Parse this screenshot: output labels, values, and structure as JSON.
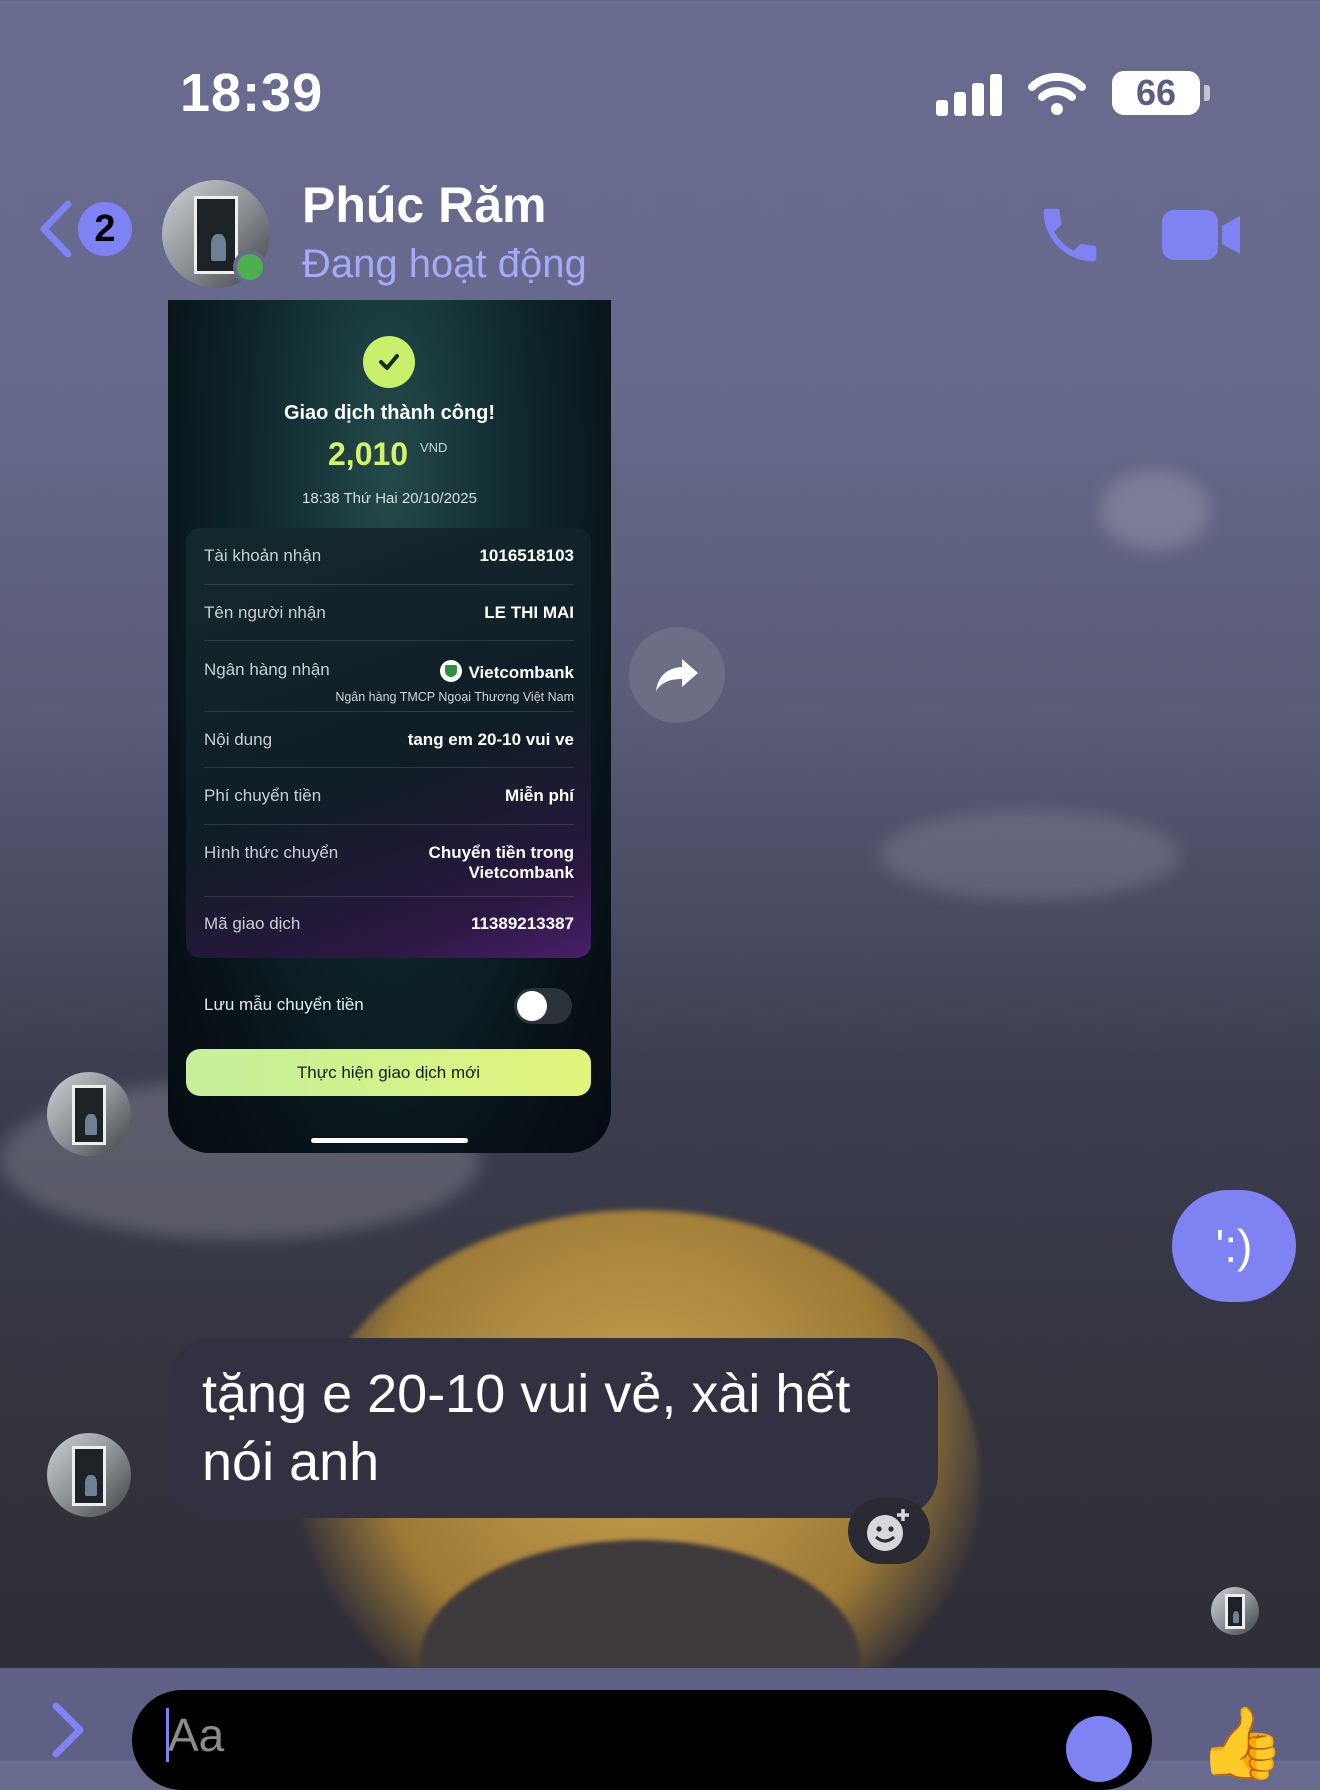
{
  "status_bar": {
    "time": "18:39",
    "battery": "66"
  },
  "header": {
    "back_badge": "2",
    "contact_name": "Phúc Răm",
    "contact_status": "Đang hoạt động"
  },
  "receipt": {
    "title": "Giao dịch thành công!",
    "amount": "2,010",
    "currency": "VND",
    "datetime": "18:38 Thứ Hai 20/10/2025",
    "rows": [
      {
        "label": "Tài khoản nhận",
        "value": "1016518103"
      },
      {
        "label": "Tên người nhận",
        "value": "LE THI MAI"
      },
      {
        "label": "Ngân hàng nhận",
        "value": "Vietcombank",
        "sub": "Ngân hàng TMCP Ngoại Thương Việt Nam"
      },
      {
        "label": "Nội dung",
        "value": "tang em 20-10 vui ve"
      },
      {
        "label": "Phí chuyển tiền",
        "value": "Miễn phí"
      },
      {
        "label": "Hình thức chuyển",
        "value_line1": "Chuyển tiền trong",
        "value_line2": "Vietcombank"
      },
      {
        "label": "Mã giao dịch",
        "value": "11389213387"
      }
    ],
    "save_template_label": "Lưu mẫu chuyển tiền",
    "new_transaction_button": "Thực hiện giao dịch mới"
  },
  "messages": {
    "emoticon": "':)",
    "text_line1": "tặng e 20-10 vui vẻ, xài hết",
    "text_line2": "nói anh"
  },
  "composer": {
    "placeholder": "Aa"
  },
  "colors": {
    "accent": "#7e82f3",
    "online": "#4caf50",
    "receipt_accent": "#d5f26b"
  },
  "icons": [
    "back-chevron-icon",
    "phone-icon",
    "video-camera-icon",
    "check-icon",
    "forward-icon",
    "add-reaction-icon",
    "expand-chevron-icon",
    "emoji-icon",
    "thumbs-up-icon",
    "signal-icon",
    "wifi-icon",
    "battery-icon"
  ]
}
